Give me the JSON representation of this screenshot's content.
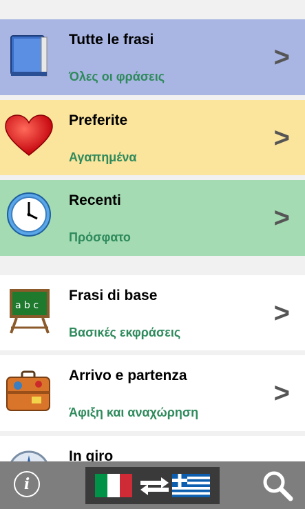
{
  "items": [
    {
      "title": "Tutte le frasi",
      "subtitle": "Όλες οι φράσεις",
      "icon": "book-icon",
      "bg": "#a9b5e2",
      "chevron": ">"
    },
    {
      "title": "Preferite",
      "subtitle": "Αγαπημένα",
      "icon": "heart-icon",
      "bg": "#fbe49b",
      "chevron": ">"
    },
    {
      "title": "Recenti",
      "subtitle": "Πρόσφατο",
      "icon": "clock-icon",
      "bg": "#a4dbb3",
      "chevron": ">"
    },
    {
      "title": "Frasi di base",
      "subtitle": "Βασικές εκφράσεις",
      "icon": "chalkboard-icon",
      "bg": "#ffffff",
      "chevron": ">"
    },
    {
      "title": "Arrivo e partenza",
      "subtitle": "Άφιξη και αναχώρηση",
      "icon": "suitcase-icon",
      "bg": "#ffffff",
      "chevron": ">"
    },
    {
      "title": "In giro",
      "subtitle": "",
      "icon": "compass-icon",
      "bg": "#ffffff",
      "chevron": ""
    }
  ],
  "bottom_bar": {
    "info_label": "i",
    "language_toggle": {
      "from": "Italian flag",
      "to": "Greek flag",
      "icon": "swap-arrows-icon"
    },
    "search_icon": "search-icon"
  }
}
